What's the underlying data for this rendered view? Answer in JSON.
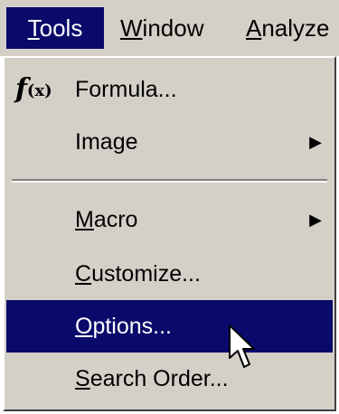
{
  "menubar": {
    "items": [
      {
        "mnemonic": "T",
        "rest": "ools",
        "active": true
      },
      {
        "mnemonic": "W",
        "rest": "indow",
        "active": false
      },
      {
        "mnemonic": "A",
        "rest": "nalyze",
        "active": false
      }
    ]
  },
  "menu": {
    "items": [
      {
        "icon": "function-fx-icon",
        "prefix": "",
        "mnemonic": "",
        "rest": "Formula...",
        "submenu": false,
        "highlighted": false
      },
      {
        "icon": "",
        "prefix": "Ima",
        "mnemonic": "g",
        "rest": "e",
        "submenu": true,
        "highlighted": false
      },
      {
        "icon": "",
        "prefix": "",
        "mnemonic": "M",
        "rest": "acro",
        "submenu": true,
        "highlighted": false
      },
      {
        "icon": "",
        "prefix": "",
        "mnemonic": "C",
        "rest": "ustomize...",
        "submenu": false,
        "highlighted": false
      },
      {
        "icon": "",
        "prefix": "",
        "mnemonic": "O",
        "rest": "ptions...",
        "submenu": false,
        "highlighted": true
      },
      {
        "icon": "",
        "prefix": "",
        "mnemonic": "S",
        "rest": "earch Order...",
        "submenu": false,
        "highlighted": false
      }
    ],
    "submenu_arrow": "▶"
  },
  "icons": {
    "formula_icon_glyph": "f",
    "formula_icon_sub": "(x)",
    "cursor": "mouse-pointer-icon"
  },
  "colors": {
    "highlight": "#0a0a6b",
    "menu_background": "#d4d0c8"
  }
}
